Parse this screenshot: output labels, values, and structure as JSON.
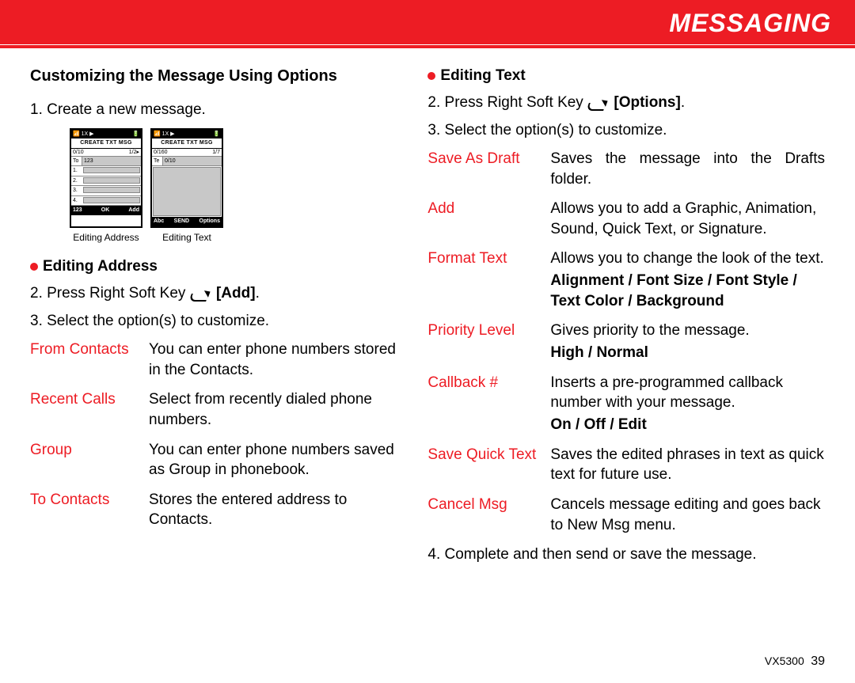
{
  "header": {
    "title": "MESSAGING"
  },
  "left": {
    "section_title": "Customizing the Message Using Options",
    "step1": "1. Create a new message.",
    "phone1": {
      "status_left": "📶 1X ▶",
      "status_right": "🔋",
      "title": "CREATE TXT MSG",
      "sub_left": "0/10",
      "sub_right": "1/2▸",
      "to_label": "To",
      "to_val": "123",
      "rows": [
        "1.",
        "2.",
        "3.",
        "4."
      ],
      "sk_left": "123",
      "sk_mid": "OK",
      "sk_right": "Add"
    },
    "phone2": {
      "status_left": "📶 1X ▶",
      "status_right": "🔋",
      "title": "CREATE TXT MSG",
      "sub_left": "0/160",
      "sub_right": "1/7",
      "to_label": "Te",
      "to_val": "0/10",
      "sk_left": "Abc",
      "sk_mid": "SEND",
      "sk_right": "Options"
    },
    "caption1": "Editing Address",
    "caption2": "Editing Text",
    "sub1_title": "Editing Address",
    "step2_pre": "2. Press Right Soft Key ",
    "step2_key": "[Add]",
    "step2_post": ".",
    "step3": "3. Select the option(s) to customize.",
    "options": [
      {
        "term": "From Contacts",
        "desc": "You can enter phone numbers stored in the Contacts."
      },
      {
        "term": "Recent Calls",
        "desc": "Select from recently dialed phone numbers."
      },
      {
        "term": "Group",
        "desc": "You can enter phone numbers saved as Group in phonebook."
      },
      {
        "term": "To Contacts",
        "desc": "Stores the entered address to Contacts."
      }
    ]
  },
  "right": {
    "sub_title": "Editing Text",
    "step2_pre": "2. Press Right Soft Key ",
    "step2_key": "[Options]",
    "step2_post": ".",
    "step3": "3. Select the option(s) to customize.",
    "options": [
      {
        "term": "Save As Draft",
        "desc": "Saves the message into the Drafts folder.",
        "sub": ""
      },
      {
        "term": "Add",
        "desc": "Allows you to add a Graphic, Animation, Sound, Quick Text, or Signature.",
        "sub": ""
      },
      {
        "term": "Format Text",
        "desc": "Allows you to change the look of the text.",
        "sub": "Alignment / Font Size / Font Style / Text Color / Background"
      },
      {
        "term": "Priority Level",
        "desc": "Gives priority to the message.",
        "sub": "High / Normal"
      },
      {
        "term": "Callback #",
        "desc": "Inserts a pre-programmed callback number with your message.",
        "sub": "On / Off / Edit"
      },
      {
        "term": "Save Quick Text",
        "desc": "Saves the edited phrases in text as quick text for future use.",
        "sub": ""
      },
      {
        "term": "Cancel Msg",
        "desc": "Cancels message editing and goes back to New Msg menu.",
        "sub": ""
      }
    ],
    "step4": "4. Complete and then send or save the message."
  },
  "footer": {
    "model": "VX5300",
    "page": "39"
  }
}
